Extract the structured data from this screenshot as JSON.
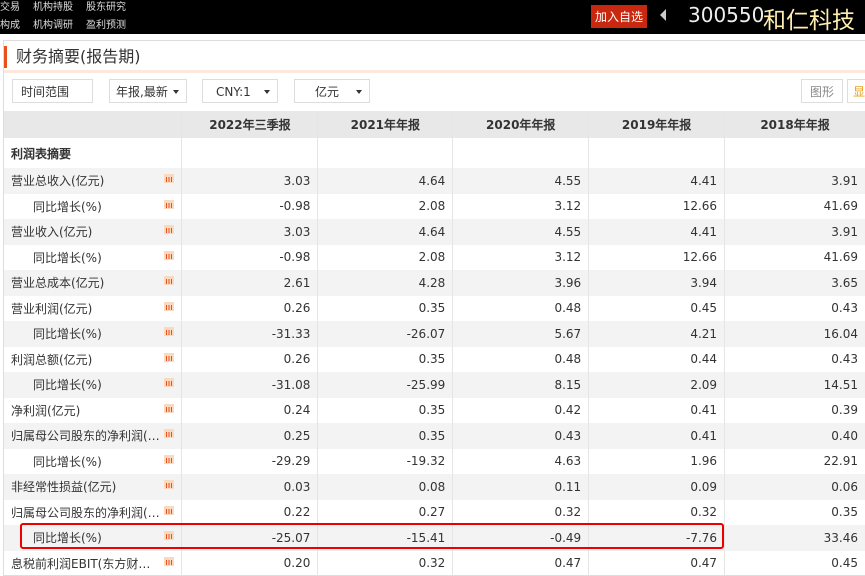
{
  "topnav": {
    "row1": [
      "交易",
      "机构持股",
      "股东研究"
    ],
    "row2": [
      "构成",
      "机构调研",
      "盈利预测"
    ],
    "add_label": "加入自选",
    "code": "300550",
    "name": "和仁科技"
  },
  "panel": {
    "title": "财务摘要(报告期)",
    "time_range": "时间范围",
    "period": "年报,最新",
    "currency": "CNY:1",
    "unit": "亿元",
    "chart_btn": "图形",
    "extra_btn": "显"
  },
  "accent": "#e8501c",
  "table": {
    "headers": [
      "",
      "2022年三季报",
      "2021年年报",
      "2020年年报",
      "2019年年报",
      "2018年年报"
    ],
    "section": "利润表摘要",
    "rows": [
      {
        "label": "营业总收入(亿元)",
        "indent": false,
        "values": [
          "3.03",
          "4.64",
          "4.55",
          "4.41",
          "3.91"
        ]
      },
      {
        "label": "同比增长(%)",
        "indent": true,
        "values": [
          "-0.98",
          "2.08",
          "3.12",
          "12.66",
          "41.69"
        ]
      },
      {
        "label": "营业收入(亿元)",
        "indent": false,
        "values": [
          "3.03",
          "4.64",
          "4.55",
          "4.41",
          "3.91"
        ]
      },
      {
        "label": "同比增长(%)",
        "indent": true,
        "values": [
          "-0.98",
          "2.08",
          "3.12",
          "12.66",
          "41.69"
        ]
      },
      {
        "label": "营业总成本(亿元)",
        "indent": false,
        "values": [
          "2.61",
          "4.28",
          "3.96",
          "3.94",
          "3.65"
        ]
      },
      {
        "label": "营业利润(亿元)",
        "indent": false,
        "values": [
          "0.26",
          "0.35",
          "0.48",
          "0.45",
          "0.43"
        ]
      },
      {
        "label": "同比增长(%)",
        "indent": true,
        "values": [
          "-31.33",
          "-26.07",
          "5.67",
          "4.21",
          "16.04"
        ]
      },
      {
        "label": "利润总额(亿元)",
        "indent": false,
        "values": [
          "0.26",
          "0.35",
          "0.48",
          "0.44",
          "0.43"
        ]
      },
      {
        "label": "同比增长(%)",
        "indent": true,
        "values": [
          "-31.08",
          "-25.99",
          "8.15",
          "2.09",
          "14.51"
        ]
      },
      {
        "label": "净利润(亿元)",
        "indent": false,
        "values": [
          "0.24",
          "0.35",
          "0.42",
          "0.41",
          "0.39"
        ]
      },
      {
        "label": "归属母公司股东的净利润(…",
        "indent": false,
        "values": [
          "0.25",
          "0.35",
          "0.43",
          "0.41",
          "0.40"
        ]
      },
      {
        "label": "同比增长(%)",
        "indent": true,
        "values": [
          "-29.29",
          "-19.32",
          "4.63",
          "1.96",
          "22.91"
        ]
      },
      {
        "label": "非经常性损益(亿元)",
        "indent": false,
        "values": [
          "0.03",
          "0.08",
          "0.11",
          "0.09",
          "0.06"
        ]
      },
      {
        "label": "归属母公司股东的净利润(…",
        "indent": false,
        "values": [
          "0.22",
          "0.27",
          "0.32",
          "0.32",
          "0.35"
        ]
      },
      {
        "label": "同比增长(%)",
        "indent": true,
        "values": [
          "-25.07",
          "-15.41",
          "-0.49",
          "-7.76",
          "33.46"
        ]
      },
      {
        "label": "息税前利润EBIT(东方财…",
        "indent": false,
        "values": [
          "0.20",
          "0.32",
          "0.47",
          "0.47",
          "0.45"
        ]
      }
    ]
  }
}
